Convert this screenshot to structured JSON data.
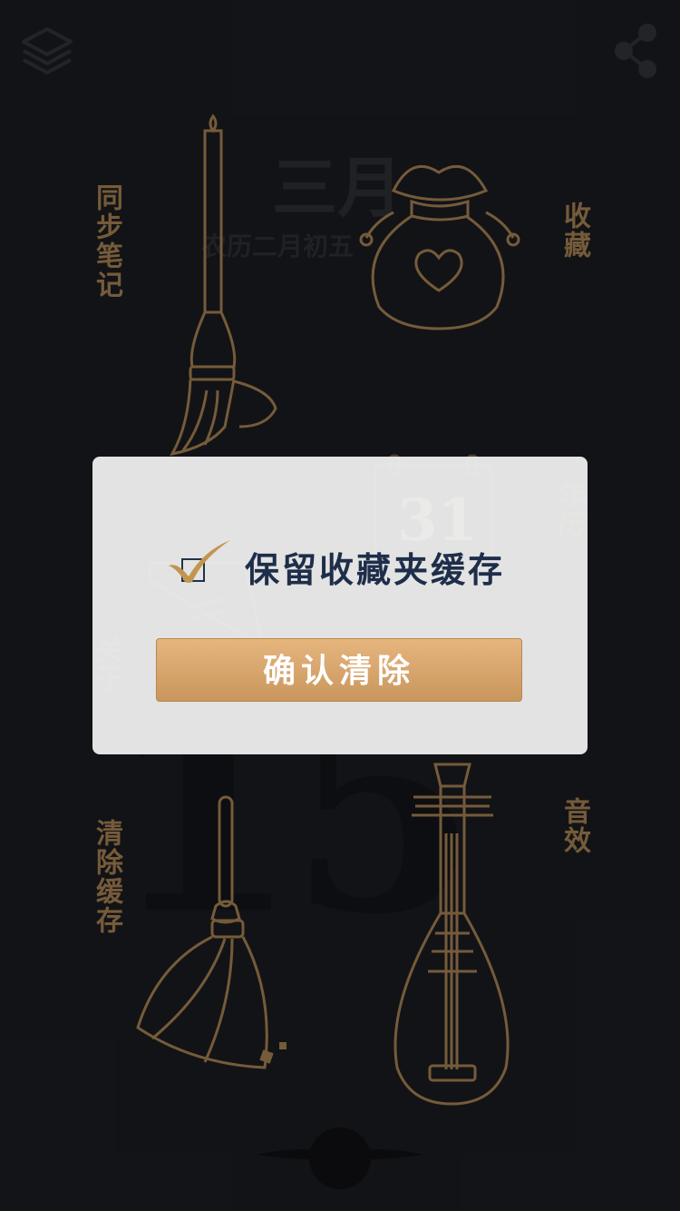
{
  "background": {
    "month": "三月",
    "lunar": "农历二月初五",
    "calendar_day": "31",
    "big_date": "15"
  },
  "menu": {
    "sync_notes": "同步笔记",
    "favorites": "收藏",
    "calendar": "年历",
    "about": "关于",
    "clear_cache": "清除缓存",
    "sound": "音效"
  },
  "dialog": {
    "checkbox_label": "保留收藏夹缓存",
    "checked": true,
    "confirm_label": "确认清除"
  },
  "colors": {
    "background": "#16171b",
    "gold": "#8a6c45",
    "dialog": "#ececec",
    "button_top": "#e6b57e",
    "button_bottom": "#c9975d",
    "label": "#1e2e4a"
  },
  "icons": [
    "layers-icon",
    "share-icon",
    "brush-icon",
    "pouch-icon",
    "calendar-icon",
    "scroll-icon",
    "broom-icon",
    "pipa-icon",
    "cloud-icon",
    "checkmark-icon"
  ]
}
